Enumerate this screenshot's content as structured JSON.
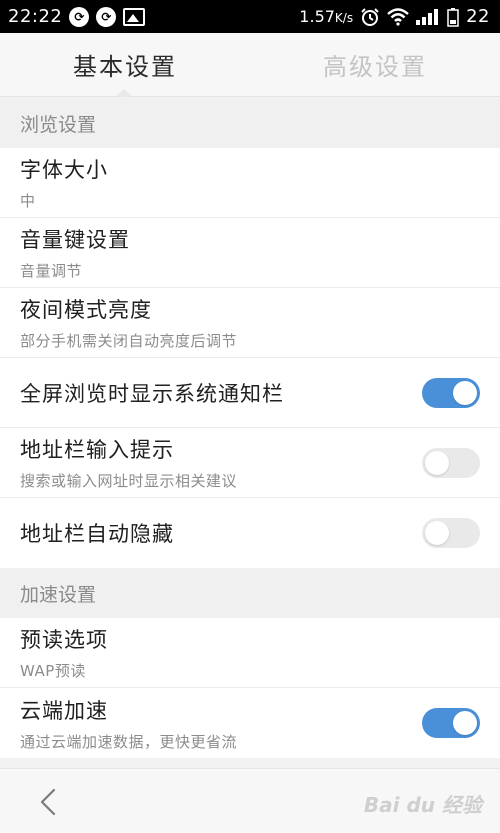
{
  "status_bar": {
    "time": "22:22",
    "battery_text": "1.57",
    "speed_unit": "K/s",
    "right_number": "22",
    "icons": [
      "sync-icon",
      "sync-icon",
      "image-icon",
      "alarm-icon",
      "wifi-icon",
      "signal-icon"
    ]
  },
  "tabs": {
    "basic": "基本设置",
    "advanced": "高级设置",
    "active": "basic"
  },
  "sections": {
    "browse": "浏览设置",
    "speed": "加速设置"
  },
  "rows": {
    "font_size": {
      "title": "字体大小",
      "subtitle": "中"
    },
    "volume_key": {
      "title": "音量键设置",
      "subtitle": "音量调节"
    },
    "night_brightness": {
      "title": "夜间模式亮度",
      "subtitle": "部分手机需关闭自动亮度后调节"
    },
    "fullscreen_notify": {
      "title": "全屏浏览时显示系统通知栏",
      "toggle": "on"
    },
    "address_hint": {
      "title": "地址栏输入提示",
      "subtitle": "搜索或输入网址时显示相关建议",
      "toggle": "off"
    },
    "address_autohide": {
      "title": "地址栏自动隐藏",
      "toggle": "off"
    },
    "preread": {
      "title": "预读选项",
      "subtitle": "WAP预读"
    },
    "cloud_accel": {
      "title": "云端加速",
      "subtitle": "通过云端加速数据，更快更省流",
      "toggle": "on"
    }
  },
  "colors": {
    "toggle_on": "#4a90d9",
    "toggle_off": "#e9e9e9",
    "section_bg": "#f0f0f0"
  }
}
